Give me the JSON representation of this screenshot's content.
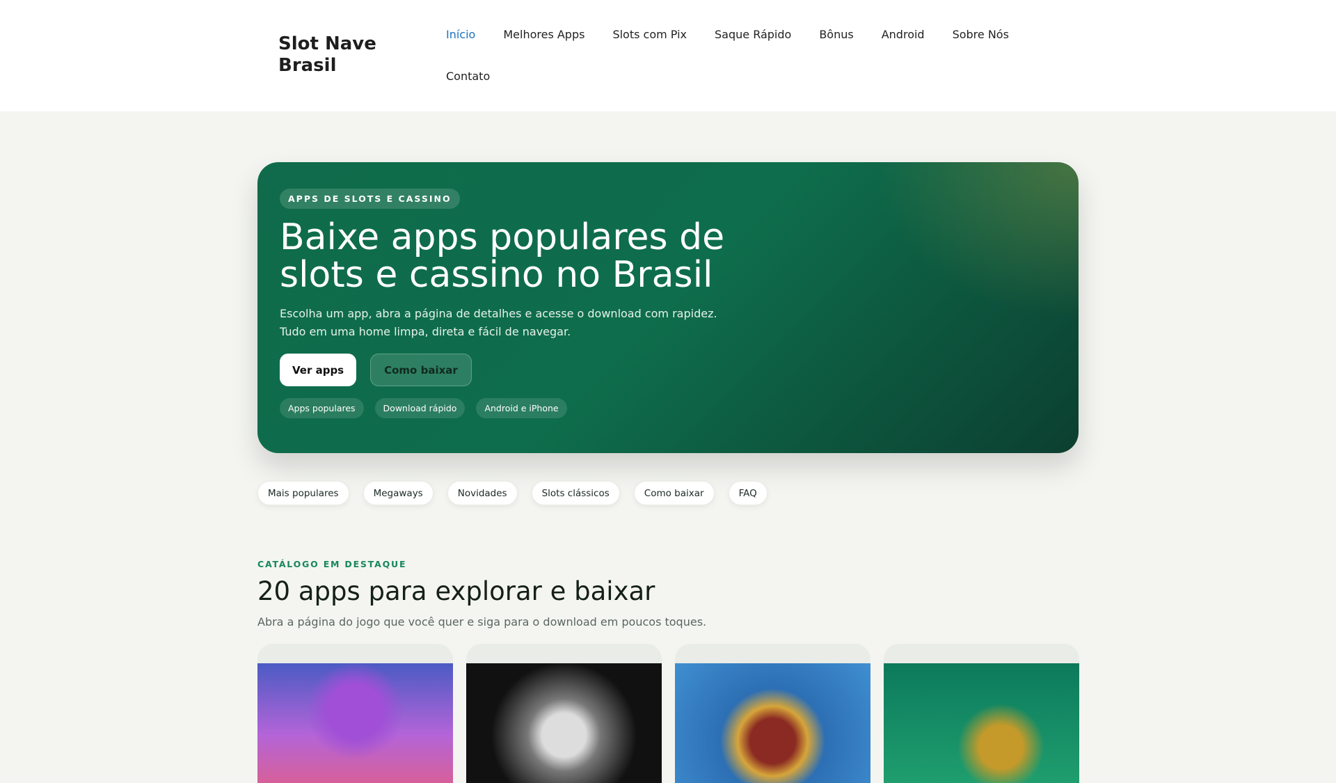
{
  "site": {
    "logo": "Slot Nave Brasil"
  },
  "nav": [
    {
      "label": "Início",
      "active": true
    },
    {
      "label": "Melhores Apps"
    },
    {
      "label": "Slots com Pix"
    },
    {
      "label": "Saque Rápido"
    },
    {
      "label": "Bônus"
    },
    {
      "label": "Android"
    },
    {
      "label": "Sobre Nós"
    },
    {
      "label": "Contato"
    }
  ],
  "hero": {
    "badge": "APPS DE SLOTS E CASSINO",
    "title": "Baixe apps populares de slots e cassino no Brasil",
    "line1": "Escolha um app, abra a página de detalhes e acesse o download com rapidez.",
    "line2": "Tudo em uma home limpa, direta e fácil de navegar.",
    "primary": "Ver apps",
    "secondary": "Como baixar",
    "chips": [
      "Apps populares",
      "Download rápido",
      "Android e iPhone"
    ]
  },
  "filters": [
    "Mais populares",
    "Megaways",
    "Novidades",
    "Slots clássicos",
    "Como baixar",
    "FAQ"
  ],
  "catalog": {
    "eyebrow": "CATÁLOGO EM DESTAQUE",
    "title": "20 apps para explorar e baixar",
    "subtitle": "Abra a página do jogo que você quer e siga para o download em poucos toques."
  },
  "colors": {
    "accent": "#16875a",
    "link_active": "#1e73be",
    "hero_green": "#0f6b4b"
  }
}
